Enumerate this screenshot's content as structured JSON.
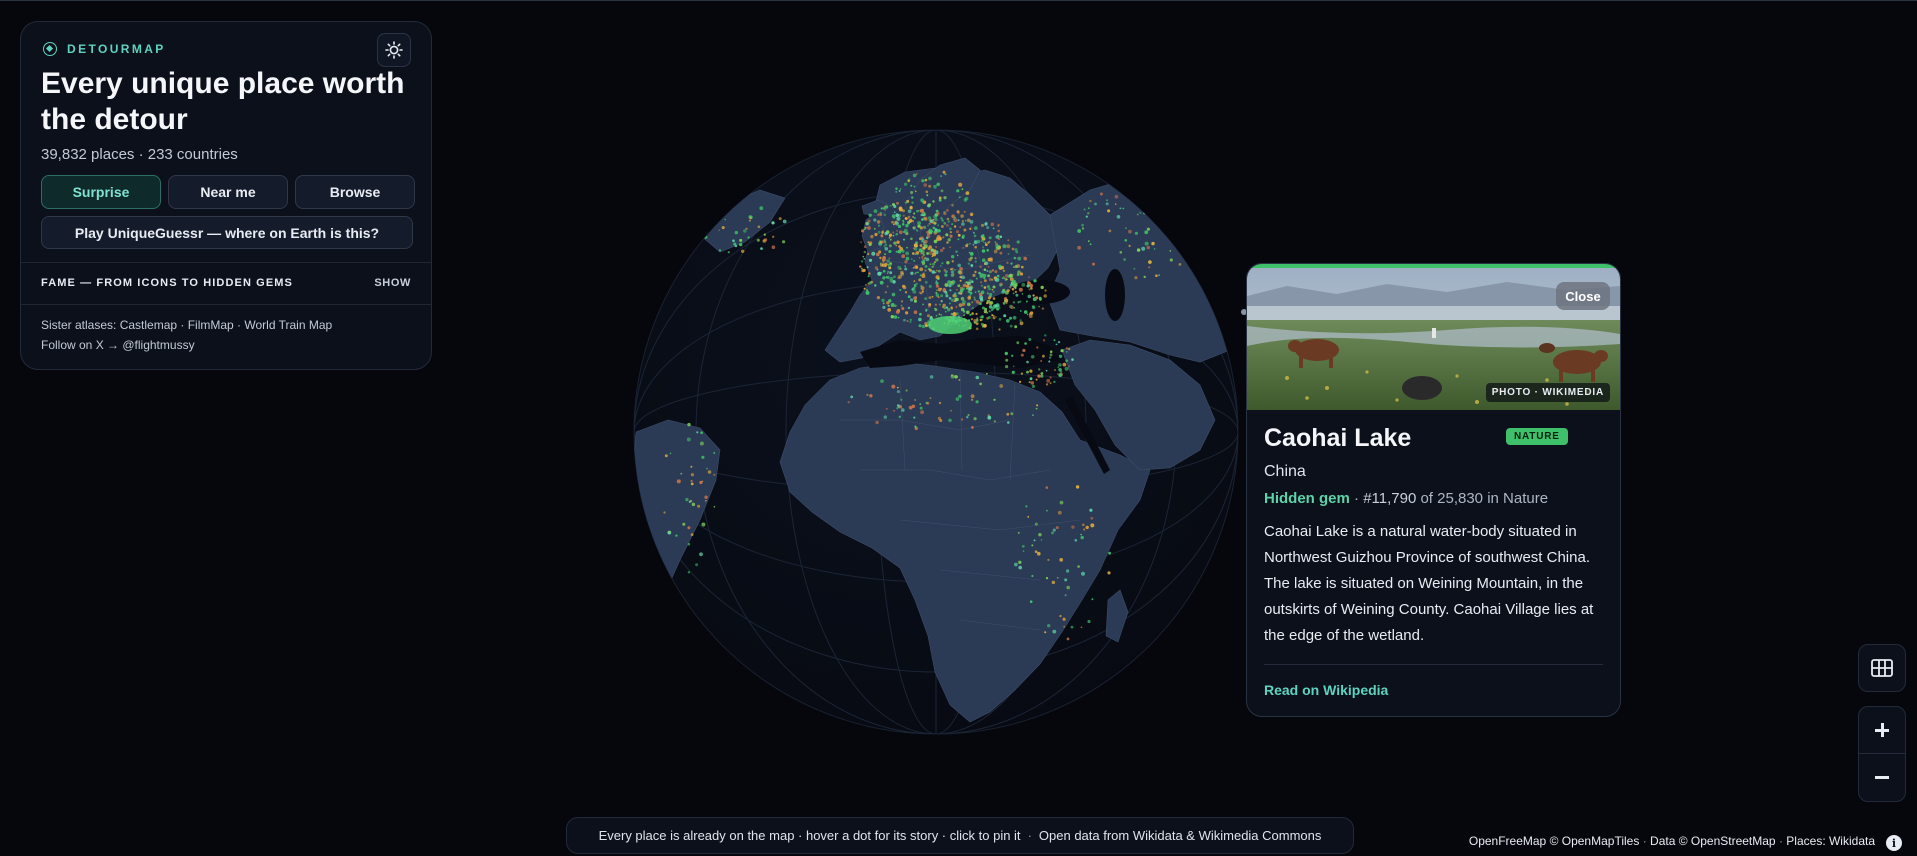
{
  "brand": {
    "name": "DETOURMAP",
    "icon": "compass-icon"
  },
  "header": {
    "title": "Every unique place worth the detour",
    "stats": "39,832 places · 233 countries"
  },
  "actions": {
    "surprise": "Surprise",
    "near_me": "Near me",
    "browse": "Browse",
    "game": "Play UniqueGuessr — where on Earth is this?"
  },
  "fame": {
    "label": "FAME — FROM ICONS TO HIDDEN GEMS",
    "toggle": "SHOW"
  },
  "footer_links": {
    "sister": "Sister atlases: Castlemap · FilmMap · World Train Map",
    "follow": "Follow on X → @flightmussy"
  },
  "place": {
    "close_label": "Close",
    "photo_credit": "PHOTO · WIKIMEDIA",
    "name": "Caohai Lake",
    "category": "NATURE",
    "country": "China",
    "fame_tier": "Hidden gem",
    "rank": "#11,790",
    "rank_suffix": "of 25,830 in Nature",
    "description": "Caohai Lake is a natural water-body situated in Northwest Guizhou Province of southwest China. The lake is situated on Weining Mountain, in the outskirts of Weining County. Caohai Village lies at the edge of the wetland.",
    "wiki_link": "Read on Wikipedia"
  },
  "map_controls": {
    "layers": "grid-icon",
    "zoom_in": "plus-icon",
    "zoom_out": "minus-icon"
  },
  "bottom_bar": {
    "hint": "Every place is already on the map · hover a dot for its story · click to pin it",
    "source": "Open data from Wikidata & Wikimedia Commons"
  },
  "attribution": {
    "tiles": "OpenFreeMap © OpenMapTiles",
    "data": "Data © OpenStreetMap",
    "places": "Places: Wikidata"
  },
  "colors": {
    "accent": "#5fd3c0",
    "nature": "#3fc06a",
    "background": "#05070d",
    "land": "#2b3a55",
    "ocean": "#090d16"
  }
}
